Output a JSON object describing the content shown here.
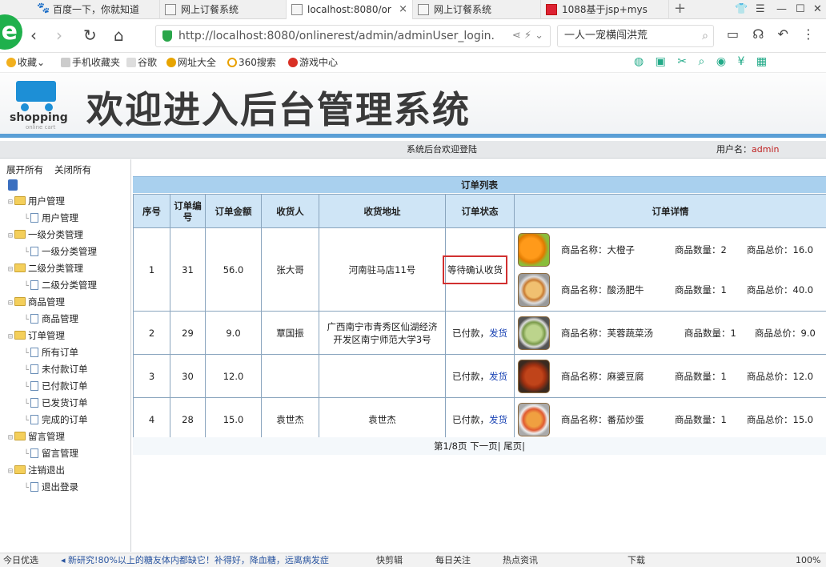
{
  "browser": {
    "tabs": [
      {
        "label": "百度一下，你就知道"
      },
      {
        "label": "网上订餐系统"
      },
      {
        "label": "localhost:8080/or"
      },
      {
        "label": "网上订餐系统"
      },
      {
        "label": "1088基于jsp+mys"
      }
    ],
    "tab_close": "×",
    "new_tab": "+",
    "url": "http://localhost:8080/onlinerest/admin/adminUser_login.",
    "search_text": "一人一宠横闯洪荒",
    "bookmarks": [
      "收藏",
      "手机收藏夹",
      "谷歌",
      "网址大全",
      "360搜索",
      "游戏中心"
    ]
  },
  "banner": {
    "logo_word": "shopping",
    "logo_sub": "online cart",
    "title": "欢迎进入后台管理系统"
  },
  "header": {
    "welcome": "系统后台欢迎登陆",
    "user_label": "用户名：",
    "username": "admin"
  },
  "sidebar": {
    "expand_all": "展开所有",
    "collapse_all": "关闭所有",
    "tree": [
      {
        "label": "用户管理",
        "level": 0
      },
      {
        "label": "用户管理",
        "level": 1
      },
      {
        "label": "一级分类管理",
        "level": 0
      },
      {
        "label": "一级分类管理",
        "level": 1
      },
      {
        "label": "二级分类管理",
        "level": 0
      },
      {
        "label": "二级分类管理",
        "level": 1
      },
      {
        "label": "商品管理",
        "level": 0
      },
      {
        "label": "商品管理",
        "level": 1
      },
      {
        "label": "订单管理",
        "level": 0
      },
      {
        "label": "所有订单",
        "level": 1
      },
      {
        "label": "未付款订单",
        "level": 1
      },
      {
        "label": "已付款订单",
        "level": 1
      },
      {
        "label": "已发货订单",
        "level": 1
      },
      {
        "label": "完成的订单",
        "level": 1
      },
      {
        "label": "留言管理",
        "level": 0
      },
      {
        "label": "留言管理",
        "level": 1
      },
      {
        "label": "注销退出",
        "level": 0
      },
      {
        "label": "退出登录",
        "level": 1
      }
    ]
  },
  "orders": {
    "title": "订单列表",
    "columns": [
      "序号",
      "订单编号",
      "订单金额",
      "收货人",
      "收货地址",
      "订单状态",
      "订单详情"
    ],
    "rows": [
      {
        "seq": "1",
        "order_no": "31",
        "amount": "56.0",
        "receiver": "张大哥",
        "address": "河南驻马店11号",
        "status": "等待确认收货",
        "ship": "",
        "items": [
          {
            "name": "商品名称：大橙子",
            "qty": "商品数量：2",
            "total": "商品总价：16.0",
            "img": "orange"
          },
          {
            "name": "商品名称：酸汤肥牛",
            "qty": "商品数量：1",
            "total": "商品总价：40.0",
            "img": "soup"
          }
        ]
      },
      {
        "seq": "2",
        "order_no": "29",
        "amount": "9.0",
        "receiver": "覃国振",
        "address": "广西南宁市青秀区仙湖经济开发区南宁师范大学3号",
        "status": "已付款，",
        "ship": "发货",
        "items": [
          {
            "name": "商品名称：芙蓉蔬菜汤",
            "qty": "商品数量：1",
            "total": "商品总价：9.0",
            "img": "veg"
          }
        ]
      },
      {
        "seq": "3",
        "order_no": "30",
        "amount": "12.0",
        "receiver": "",
        "address": "",
        "status": "已付款，",
        "ship": "发货",
        "items": [
          {
            "name": "商品名称：麻婆豆腐",
            "qty": "商品数量：1",
            "total": "商品总价：12.0",
            "img": "tofu"
          }
        ]
      },
      {
        "seq": "4",
        "order_no": "28",
        "amount": "15.0",
        "receiver": "袁世杰",
        "address": "袁世杰",
        "status": "已付款，",
        "ship": "发货",
        "items": [
          {
            "name": "商品名称：番茄炒蛋",
            "qty": "商品数量：1",
            "total": "商品总价：15.0",
            "img": "egg"
          }
        ]
      }
    ],
    "pager": {
      "info": "第1/8页",
      "next": "下一页|",
      "last": "尾页|"
    }
  },
  "statusbar": {
    "left": "今日优选",
    "news": "新研究!80%以上的糖友体内都缺它！补得好，降血糖，远离病发症",
    "items": [
      "快剪辑",
      "每日关注",
      "热点资讯",
      "下载"
    ],
    "zoom": "100%"
  }
}
